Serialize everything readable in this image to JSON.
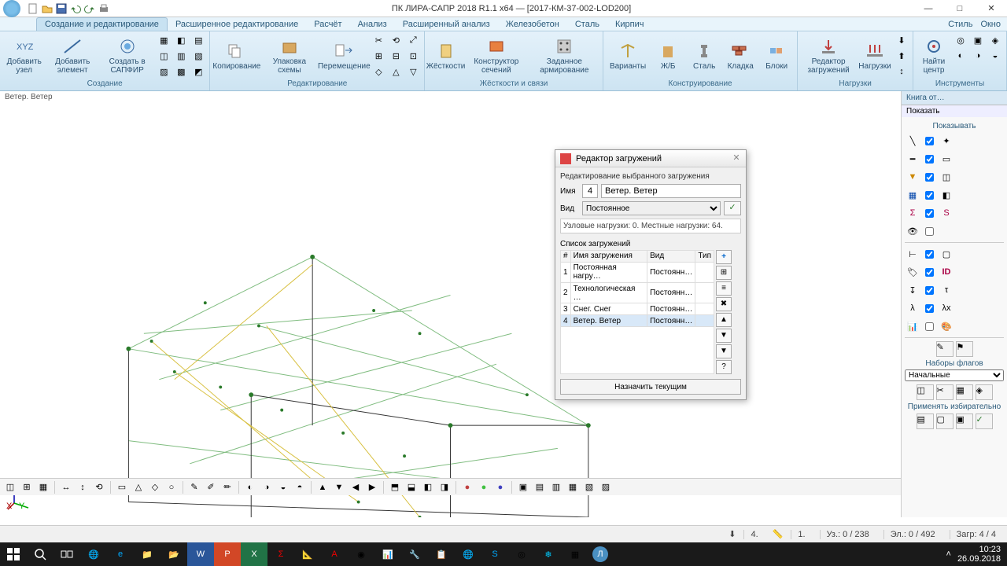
{
  "app_title": "ПК ЛИРА-САПР 2018 R1.1 x64 — [2017-КМ-37-002-LOD200]",
  "menubar": {
    "tabs": [
      "Создание и редактирование",
      "Расширенное редактирование",
      "Расчёт",
      "Анализ",
      "Расширенный анализ",
      "Железобетон",
      "Сталь",
      "Кирпич"
    ],
    "right": [
      "Стиль",
      "Окно"
    ]
  },
  "ribbon": {
    "groups": [
      {
        "label": "Создание",
        "big": [
          {
            "l": "Добавить\nузел"
          },
          {
            "l": "Добавить\nэлемент"
          },
          {
            "l": "Создать в\nСАПФИР"
          }
        ]
      },
      {
        "label": "Редактирование",
        "big": [
          {
            "l": "Копирование"
          },
          {
            "l": "Упаковка\nсхемы"
          },
          {
            "l": "Перемещение"
          }
        ]
      },
      {
        "label": "Жёсткости и связи",
        "big": [
          {
            "l": "Жёсткости"
          },
          {
            "l": "Конструктор\nсечений"
          },
          {
            "l": "Заданное\nармирование"
          }
        ]
      },
      {
        "label": "Конструирование",
        "big": [
          {
            "l": "Варианты"
          },
          {
            "l": "Ж/Б"
          },
          {
            "l": "Сталь"
          },
          {
            "l": "Кладка"
          },
          {
            "l": "Блоки"
          }
        ]
      },
      {
        "label": "Нагрузки",
        "big": [
          {
            "l": "Редактор\nзагружений"
          },
          {
            "l": "Нагрузки"
          }
        ]
      },
      {
        "label": "Инструменты",
        "big": [
          {
            "l": "Найти\nцентр"
          }
        ]
      }
    ]
  },
  "doc_label": "Ветер. Ветер",
  "dialog": {
    "title": "Редактор загружений",
    "subtitle": "Редактирование выбранного загружения",
    "name_label": "Имя",
    "num": "4",
    "name": "Ветер. Ветер",
    "vid_label": "Вид",
    "vid": "Постоянное",
    "info": "Узловые нагрузки: 0.  Местные нагрузки: 64.",
    "list_title": "Список загружений",
    "headers": [
      "#",
      "Имя загружения",
      "Вид",
      "Тип"
    ],
    "rows": [
      [
        "1",
        "Постоянная нагру…",
        "Постоянн…",
        ""
      ],
      [
        "2",
        "Технологическая …",
        "Постоянн…",
        ""
      ],
      [
        "3",
        "Снег. Снег",
        "Постоянн…",
        ""
      ],
      [
        "4",
        "Ветер. Ветер",
        "Постоянн…",
        ""
      ]
    ],
    "assign": "Назначить текущим"
  },
  "right_panel": {
    "tab1": "Книга от…",
    "tab2": "Показать",
    "show_title": "Показывать",
    "flags_title": "Наборы флагов",
    "preset": "Начальные",
    "apply_title": "Применять избирательно"
  },
  "status": {
    "load_num": "4.",
    "scale": "1.",
    "nodes": "Уз.: 0 / 238",
    "elems": "Эл.: 0 / 492",
    "loadcase": "Загр: 4 / 4"
  },
  "clock": {
    "time": "10:23",
    "date": "26.09.2018"
  }
}
